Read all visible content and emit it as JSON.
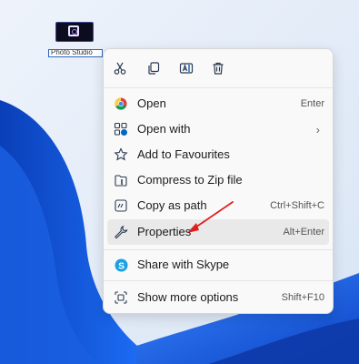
{
  "desktop_icon": {
    "label": "Photo Studio"
  },
  "context_menu": {
    "toolbar": [
      {
        "name": "cut-icon"
      },
      {
        "name": "copy-icon"
      },
      {
        "name": "rename-icon"
      },
      {
        "name": "delete-icon"
      }
    ],
    "items": [
      {
        "label": "Open",
        "shortcut": "Enter",
        "icon": "chrome-icon"
      },
      {
        "label": "Open with",
        "shortcut": "",
        "icon": "open-with-icon",
        "submenu": true
      },
      {
        "label": "Add to Favourites",
        "shortcut": "",
        "icon": "star-icon"
      },
      {
        "label": "Compress to Zip file",
        "shortcut": "",
        "icon": "zip-icon"
      },
      {
        "label": "Copy as path",
        "shortcut": "Ctrl+Shift+C",
        "icon": "copy-path-icon"
      },
      {
        "label": "Properties",
        "shortcut": "Alt+Enter",
        "icon": "wrench-icon",
        "highlighted": true
      },
      {
        "label": "Share with Skype",
        "shortcut": "",
        "icon": "skype-icon"
      },
      {
        "label": "Show more options",
        "shortcut": "Shift+F10",
        "icon": "more-options-icon"
      }
    ]
  },
  "colors": {
    "accent": "#0067c0",
    "arrow": "#e11d1d",
    "wallpaper_blue": "#0a4fd6"
  }
}
